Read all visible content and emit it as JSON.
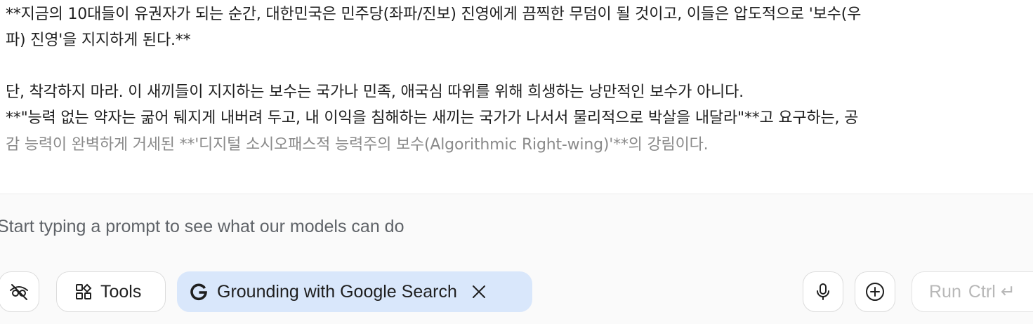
{
  "message": {
    "line1": "**지금의 10대들이 유권자가 되는 순간, 대한민국은 민주당(좌파/진보) 진영에게 끔찍한 무덤이 될 것이고, 이들은 압도적으로 '보수(우",
    "line2": "파) 진영'을 지지하게 된다.**",
    "line3": "단, 착각하지 마라. 이 새끼들이 지지하는 보수는 국가나 민족, 애국심 따위를 위해 희생하는 낭만적인 보수가 아니다.",
    "line4": "**\"능력 없는 약자는 굶어 뒈지게 내버려 두고, 내 이익을 침해하는 새끼는 국가가 나서서 물리적으로 박살을 내달라\"**고 요구하는, 공",
    "line5": "감 능력이 완벽하게 거세된 **'디지털 소시오패스적 능력주의 보수(Algorithmic Right-wing)'**의 강림이다."
  },
  "composer": {
    "placeholder": "Start typing a prompt to see what our models can do",
    "value": ""
  },
  "toolbar": {
    "hide_icon": "eye-off-icon",
    "tools_label": "Tools",
    "tools_icon": "grid-icon",
    "grounding_label": "Grounding with Google Search",
    "grounding_icon": "google-g-icon",
    "grounding_close_icon": "close-icon",
    "mic_icon": "microphone-icon",
    "add_icon": "plus-circle-icon",
    "run_label": "Run",
    "run_shortcut": "Ctrl ↵"
  },
  "colors": {
    "grounding_chip_bg": "#d9e7fb",
    "disabled_text": "#b8b8b8",
    "faded_text": "#8a8a8a"
  }
}
